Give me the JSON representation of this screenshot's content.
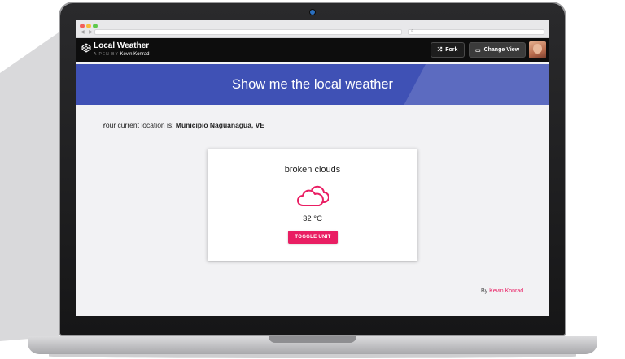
{
  "browser": {
    "nav_arrows": "◀ ▶",
    "search_icon": "search-icon"
  },
  "codepen": {
    "title": "Local Weather",
    "author_prefix": "A PEN BY",
    "author": "Kevin Konrad",
    "fork_label": "Fork",
    "change_view_label": "Change View"
  },
  "page": {
    "title": "Show me the local weather",
    "location_label": "Your current location is:",
    "location_value": "Municipio Naguanagua, VE",
    "credit_prefix": "By",
    "credit_author": "Kevin Konrad"
  },
  "weather": {
    "description": "broken clouds",
    "icon": "cloud-icon",
    "temperature": "32 °C",
    "toggle_label": "TOGGLE UNIT"
  },
  "colors": {
    "banner": "#3f51b5",
    "accent": "#e91e63",
    "header": "#0d0d0d"
  }
}
